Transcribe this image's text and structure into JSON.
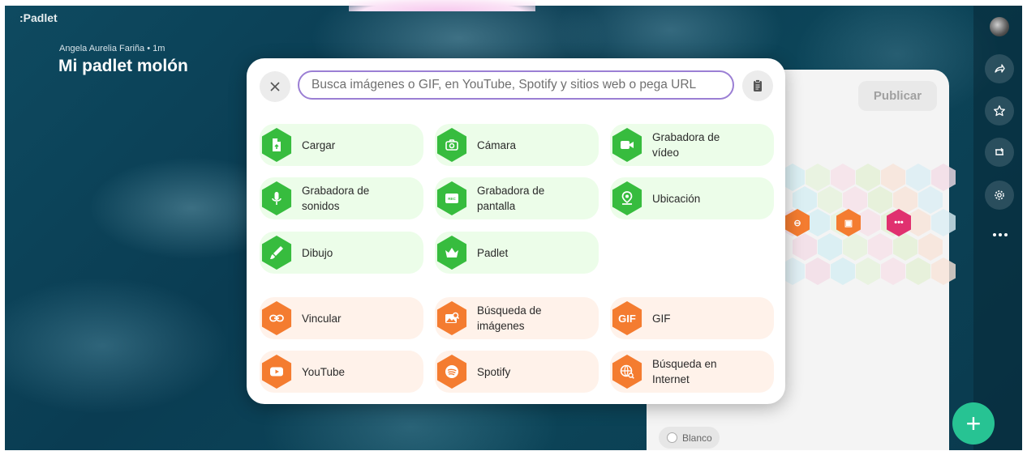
{
  "app": {
    "logo": ":Padlet"
  },
  "header": {
    "author_line": "Angela Aurelia Fariña • 1m",
    "title": "Mi padlet molón"
  },
  "composer": {
    "publish_label": "Publicar",
    "color_label": "Blanco"
  },
  "search": {
    "placeholder": "Busca imágenes o GIF, en YouTube, Spotify y sitios web o pega URL"
  },
  "attachments": {
    "items": [
      {
        "label": "Cargar",
        "icon": "upload-file-icon",
        "group": "green"
      },
      {
        "label": "Cámara",
        "icon": "camera-icon",
        "group": "green"
      },
      {
        "label": "Grabadora de vídeo",
        "icon": "video-camera-icon",
        "group": "green"
      },
      {
        "label": "Grabadora de sonidos",
        "icon": "microphone-icon",
        "group": "green"
      },
      {
        "label": "Grabadora de pantalla",
        "icon": "screen-recorder-icon",
        "group": "green"
      },
      {
        "label": "Ubicación",
        "icon": "location-pin-icon",
        "group": "green"
      },
      {
        "label": "Dibujo",
        "icon": "brush-icon",
        "group": "green"
      },
      {
        "label": "Padlet",
        "icon": "padlet-icon",
        "group": "green"
      },
      {
        "label": "Vincular",
        "icon": "link-icon",
        "group": "orange"
      },
      {
        "label": "Búsqueda de imágenes",
        "icon": "image-search-icon",
        "group": "orange"
      },
      {
        "label": "GIF",
        "icon": "gif-icon",
        "group": "orange"
      },
      {
        "label": "YouTube",
        "icon": "youtube-icon",
        "group": "orange"
      },
      {
        "label": "Spotify",
        "icon": "spotify-icon",
        "group": "orange"
      },
      {
        "label": "Búsqueda en Internet",
        "icon": "web-search-icon",
        "group": "orange"
      }
    ],
    "gif_text": "GIF"
  },
  "colors": {
    "green": "#37bc3e",
    "orange": "#f47c30",
    "accent": "#27c393",
    "search_border": "#9b7fd4",
    "pink": "#e0316f"
  }
}
